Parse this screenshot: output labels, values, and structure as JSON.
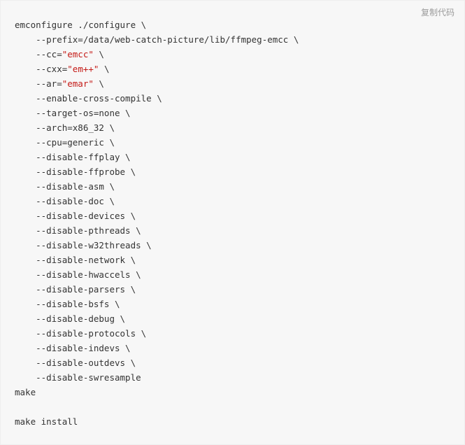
{
  "copy_label": "复制代码",
  "code": {
    "l1a": "emconfigure ./configure \\",
    "l2": "    --prefix=/data/web-catch-picture/lib/ffmpeg-emcc \\",
    "l3a": "    --cc=",
    "l3s": "\"emcc\"",
    "l3b": " \\",
    "l4a": "    --cxx=",
    "l4s": "\"em++\"",
    "l4b": " \\",
    "l5a": "    --ar=",
    "l5s": "\"emar\"",
    "l5b": " \\",
    "l6": "    --enable-cross-compile \\",
    "l7": "    --target-os=none \\",
    "l8": "    --arch=x86_32 \\",
    "l9": "    --cpu=generic \\",
    "l10": "    --disable-ffplay \\",
    "l11": "    --disable-ffprobe \\",
    "l12": "    --disable-asm \\",
    "l13": "    --disable-doc \\",
    "l14": "    --disable-devices \\",
    "l15": "    --disable-pthreads \\",
    "l16": "    --disable-w32threads \\",
    "l17": "    --disable-network \\",
    "l18": "    --disable-hwaccels \\",
    "l19": "    --disable-parsers \\",
    "l20": "    --disable-bsfs \\",
    "l21": "    --disable-debug \\",
    "l22": "    --disable-protocols \\",
    "l23": "    --disable-indevs \\",
    "l24": "    --disable-outdevs \\",
    "l25": "    --disable-swresample",
    "l26": "make",
    "l27": "",
    "l28": "make install"
  }
}
